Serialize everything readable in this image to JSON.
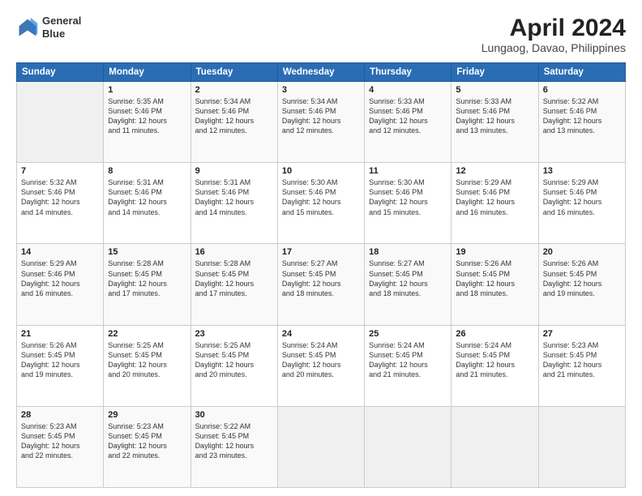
{
  "header": {
    "logo_line1": "General",
    "logo_line2": "Blue",
    "title": "April 2024",
    "subtitle": "Lungaog, Davao, Philippines"
  },
  "weekdays": [
    "Sunday",
    "Monday",
    "Tuesday",
    "Wednesday",
    "Thursday",
    "Friday",
    "Saturday"
  ],
  "weeks": [
    [
      {
        "num": "",
        "info": ""
      },
      {
        "num": "1",
        "info": "Sunrise: 5:35 AM\nSunset: 5:46 PM\nDaylight: 12 hours\nand 11 minutes."
      },
      {
        "num": "2",
        "info": "Sunrise: 5:34 AM\nSunset: 5:46 PM\nDaylight: 12 hours\nand 12 minutes."
      },
      {
        "num": "3",
        "info": "Sunrise: 5:34 AM\nSunset: 5:46 PM\nDaylight: 12 hours\nand 12 minutes."
      },
      {
        "num": "4",
        "info": "Sunrise: 5:33 AM\nSunset: 5:46 PM\nDaylight: 12 hours\nand 12 minutes."
      },
      {
        "num": "5",
        "info": "Sunrise: 5:33 AM\nSunset: 5:46 PM\nDaylight: 12 hours\nand 13 minutes."
      },
      {
        "num": "6",
        "info": "Sunrise: 5:32 AM\nSunset: 5:46 PM\nDaylight: 12 hours\nand 13 minutes."
      }
    ],
    [
      {
        "num": "7",
        "info": "Sunrise: 5:32 AM\nSunset: 5:46 PM\nDaylight: 12 hours\nand 14 minutes."
      },
      {
        "num": "8",
        "info": "Sunrise: 5:31 AM\nSunset: 5:46 PM\nDaylight: 12 hours\nand 14 minutes."
      },
      {
        "num": "9",
        "info": "Sunrise: 5:31 AM\nSunset: 5:46 PM\nDaylight: 12 hours\nand 14 minutes."
      },
      {
        "num": "10",
        "info": "Sunrise: 5:30 AM\nSunset: 5:46 PM\nDaylight: 12 hours\nand 15 minutes."
      },
      {
        "num": "11",
        "info": "Sunrise: 5:30 AM\nSunset: 5:46 PM\nDaylight: 12 hours\nand 15 minutes."
      },
      {
        "num": "12",
        "info": "Sunrise: 5:29 AM\nSunset: 5:46 PM\nDaylight: 12 hours\nand 16 minutes."
      },
      {
        "num": "13",
        "info": "Sunrise: 5:29 AM\nSunset: 5:46 PM\nDaylight: 12 hours\nand 16 minutes."
      }
    ],
    [
      {
        "num": "14",
        "info": "Sunrise: 5:29 AM\nSunset: 5:46 PM\nDaylight: 12 hours\nand 16 minutes."
      },
      {
        "num": "15",
        "info": "Sunrise: 5:28 AM\nSunset: 5:45 PM\nDaylight: 12 hours\nand 17 minutes."
      },
      {
        "num": "16",
        "info": "Sunrise: 5:28 AM\nSunset: 5:45 PM\nDaylight: 12 hours\nand 17 minutes."
      },
      {
        "num": "17",
        "info": "Sunrise: 5:27 AM\nSunset: 5:45 PM\nDaylight: 12 hours\nand 18 minutes."
      },
      {
        "num": "18",
        "info": "Sunrise: 5:27 AM\nSunset: 5:45 PM\nDaylight: 12 hours\nand 18 minutes."
      },
      {
        "num": "19",
        "info": "Sunrise: 5:26 AM\nSunset: 5:45 PM\nDaylight: 12 hours\nand 18 minutes."
      },
      {
        "num": "20",
        "info": "Sunrise: 5:26 AM\nSunset: 5:45 PM\nDaylight: 12 hours\nand 19 minutes."
      }
    ],
    [
      {
        "num": "21",
        "info": "Sunrise: 5:26 AM\nSunset: 5:45 PM\nDaylight: 12 hours\nand 19 minutes."
      },
      {
        "num": "22",
        "info": "Sunrise: 5:25 AM\nSunset: 5:45 PM\nDaylight: 12 hours\nand 20 minutes."
      },
      {
        "num": "23",
        "info": "Sunrise: 5:25 AM\nSunset: 5:45 PM\nDaylight: 12 hours\nand 20 minutes."
      },
      {
        "num": "24",
        "info": "Sunrise: 5:24 AM\nSunset: 5:45 PM\nDaylight: 12 hours\nand 20 minutes."
      },
      {
        "num": "25",
        "info": "Sunrise: 5:24 AM\nSunset: 5:45 PM\nDaylight: 12 hours\nand 21 minutes."
      },
      {
        "num": "26",
        "info": "Sunrise: 5:24 AM\nSunset: 5:45 PM\nDaylight: 12 hours\nand 21 minutes."
      },
      {
        "num": "27",
        "info": "Sunrise: 5:23 AM\nSunset: 5:45 PM\nDaylight: 12 hours\nand 21 minutes."
      }
    ],
    [
      {
        "num": "28",
        "info": "Sunrise: 5:23 AM\nSunset: 5:45 PM\nDaylight: 12 hours\nand 22 minutes."
      },
      {
        "num": "29",
        "info": "Sunrise: 5:23 AM\nSunset: 5:45 PM\nDaylight: 12 hours\nand 22 minutes."
      },
      {
        "num": "30",
        "info": "Sunrise: 5:22 AM\nSunset: 5:45 PM\nDaylight: 12 hours\nand 23 minutes."
      },
      {
        "num": "",
        "info": ""
      },
      {
        "num": "",
        "info": ""
      },
      {
        "num": "",
        "info": ""
      },
      {
        "num": "",
        "info": ""
      }
    ]
  ]
}
